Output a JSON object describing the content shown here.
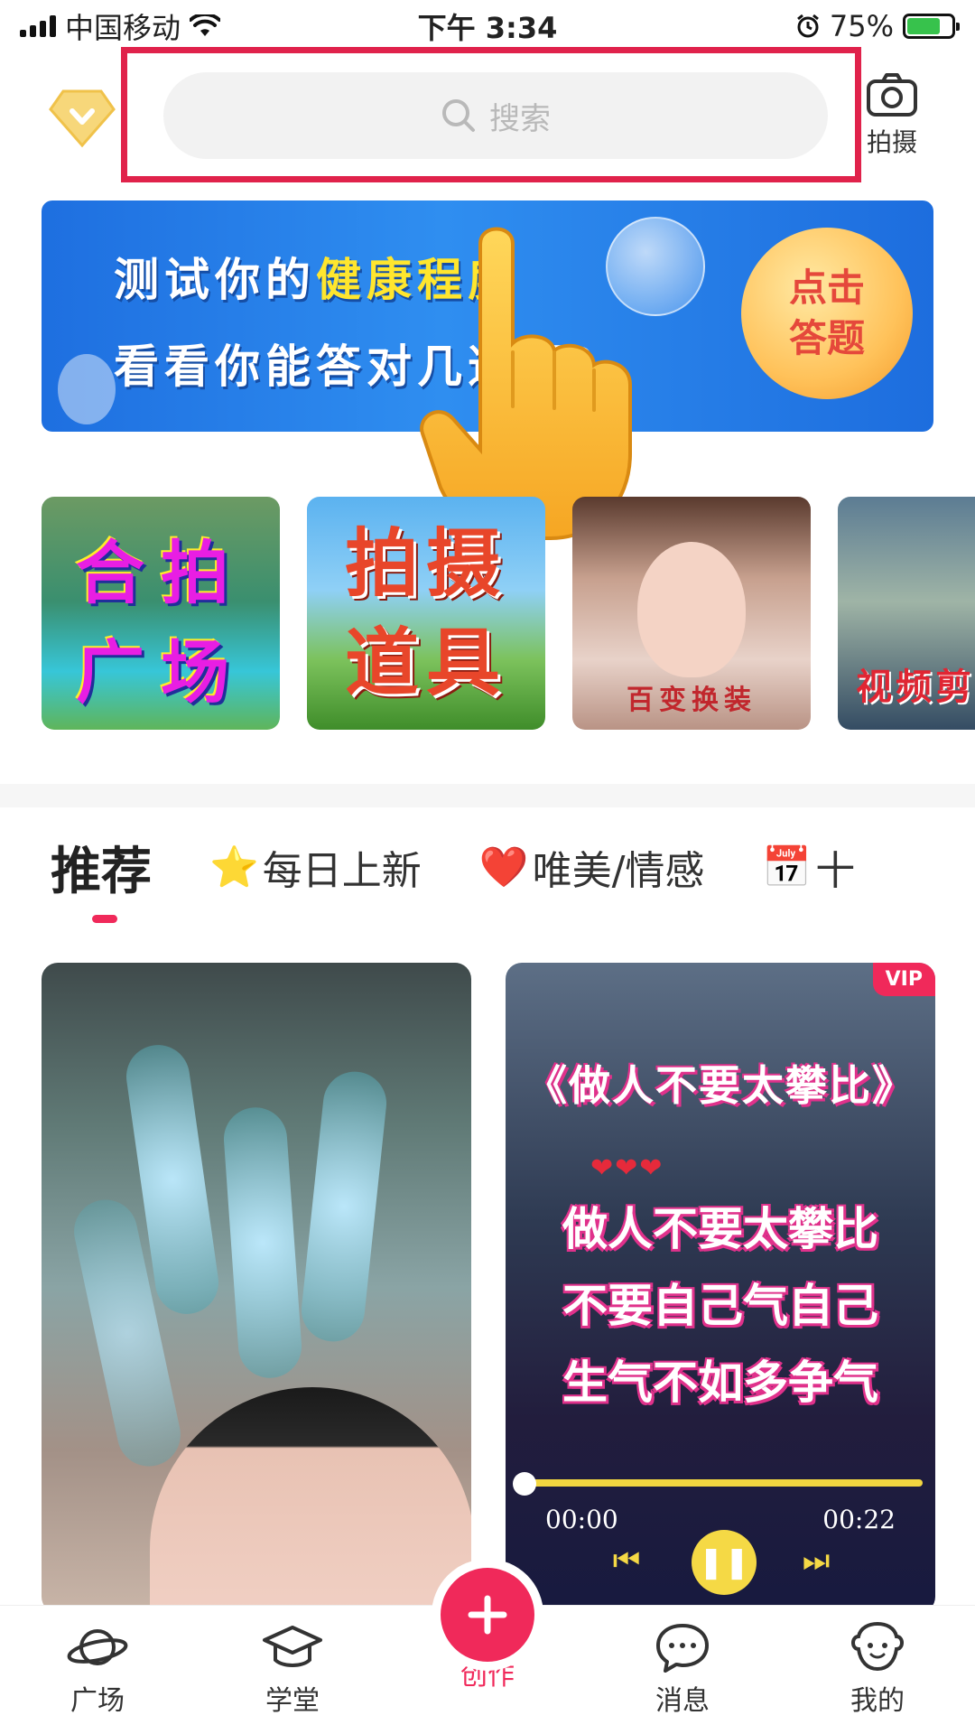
{
  "status_bar": {
    "carrier": "中国移动",
    "time": "下午 3:34",
    "battery_percent": "75%",
    "battery_level": 0.75
  },
  "header": {
    "search_placeholder": "搜索",
    "camera_label": "拍摄"
  },
  "banner": {
    "line1_prefix": "测试你的",
    "line1_highlight": "健康程度",
    "line2": "看看你能答对几道题？",
    "cta_line1": "点击",
    "cta_line2": "答题"
  },
  "tiles": [
    {
      "line1": "合拍",
      "line2": "广场"
    },
    {
      "line1": "拍摄",
      "line2": "道具"
    },
    {
      "label": "百变换装"
    },
    {
      "label": "视频剪"
    }
  ],
  "category_tabs": [
    {
      "label": "推荐",
      "emoji": "",
      "active": true
    },
    {
      "label": "每日上新",
      "emoji": "⭐",
      "active": false
    },
    {
      "label": "唯美/情感",
      "emoji": "❤️",
      "active": false
    },
    {
      "label": "十",
      "emoji": "📅",
      "active": false
    }
  ],
  "feed": {
    "right_card": {
      "vip": "VIP",
      "title": "《做人不要太攀比》",
      "hearts": "❤❤❤",
      "lyrics": [
        "做人不要太攀比",
        "不要自己气自己",
        "生气不如多争气"
      ],
      "current_time": "00:00",
      "duration": "00:22",
      "progress": 0.0
    }
  },
  "bottom_nav": [
    {
      "label": "广场",
      "icon": "planet-icon",
      "active": false
    },
    {
      "label": "学堂",
      "icon": "graduation-cap-icon",
      "active": false
    },
    {
      "label": "创作",
      "icon": "plus-icon",
      "active": true
    },
    {
      "label": "消息",
      "icon": "chat-bubble-icon",
      "active": false
    },
    {
      "label": "我的",
      "icon": "smiley-face-icon",
      "active": false
    }
  ],
  "colors": {
    "accent": "#f0295a",
    "highlight_box": "#e0224b",
    "banner_blue": "#2f8ef0",
    "progress_yellow": "#f2d540"
  }
}
